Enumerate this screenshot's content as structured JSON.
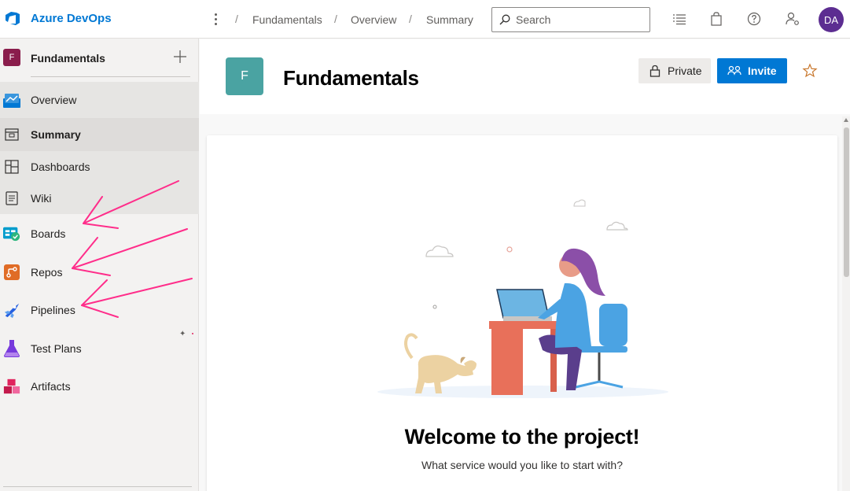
{
  "brand": {
    "name": "Azure DevOps",
    "color": "#0078d4"
  },
  "breadcrumb": [
    "Fundamentals",
    "Overview",
    "Summary"
  ],
  "search": {
    "placeholder": "Search",
    "value": ""
  },
  "user": {
    "initials": "DA",
    "color": "#5c2d91"
  },
  "topbar_icons": [
    "more-actions-icon",
    "settings-list-icon",
    "marketplace-bag-icon",
    "help-icon",
    "user-settings-icon"
  ],
  "sidebar": {
    "project": {
      "initial": "F",
      "name": "Fundamentals",
      "add_icon": "plus-icon",
      "color": "#8a1d4c"
    },
    "items": [
      {
        "label": "Overview",
        "icon": "overview-icon",
        "state": "group"
      },
      {
        "label": "Summary",
        "icon": "summary-icon",
        "state": "selected"
      },
      {
        "label": "Dashboards",
        "icon": "dashboards-icon",
        "state": "group"
      },
      {
        "label": "Wiki",
        "icon": "wiki-icon",
        "state": "group"
      },
      {
        "label": "Boards",
        "icon": "boards-icon",
        "state": ""
      },
      {
        "label": "Repos",
        "icon": "repos-icon",
        "state": ""
      },
      {
        "label": "Pipelines",
        "icon": "pipelines-icon",
        "state": ""
      },
      {
        "label": "Test Plans",
        "icon": "test-plans-icon",
        "state": ""
      },
      {
        "label": "Artifacts",
        "icon": "artifacts-icon",
        "state": ""
      }
    ]
  },
  "project_header": {
    "initial": "F",
    "title": "Fundamentals",
    "badge_color": "#4aa3a2",
    "private_label": "Private",
    "invite_label": "Invite",
    "invite_color": "#0078d4",
    "favorite_icon": "star-icon"
  },
  "welcome": {
    "title": "Welcome to the project!",
    "subtitle": "What service would you like to start with?"
  },
  "annotations": {
    "arrow_color": "#ff2d8a",
    "arrows_point_to": [
      "Boards",
      "Repos",
      "Pipelines"
    ]
  }
}
